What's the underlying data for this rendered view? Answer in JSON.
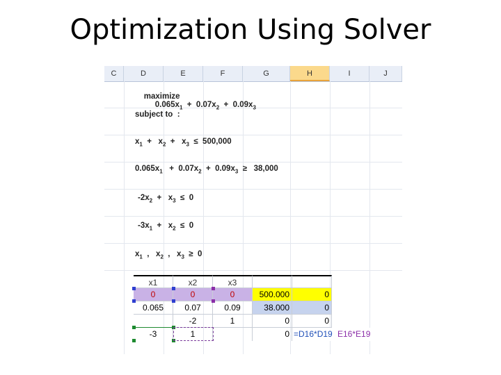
{
  "slide": {
    "title": "Optimization Using Solver"
  },
  "sheet": {
    "columns": [
      "C",
      "D",
      "E",
      "F",
      "G",
      "H",
      "I",
      "J"
    ],
    "active_column": "H",
    "model": {
      "maximize_label": "maximize",
      "objective": [
        "0.065x",
        "1",
        "  +  0.07x",
        "2",
        "  +  0.09x",
        "3"
      ],
      "subject_to": "subject to  :",
      "c1": [
        "x",
        "1",
        "  +   x",
        "2",
        "  +   x",
        "3",
        "  ≤  500,000"
      ],
      "c2": [
        "0.065x",
        "1",
        "   +  0.07x",
        "2",
        "  +  0.09x",
        "3",
        "  ≥   38,000"
      ],
      "c3": [
        "-2x",
        "2",
        "  +   x",
        "3",
        "  ≤  0"
      ],
      "c4": [
        "-3x",
        "1",
        "  +   x",
        "2",
        "  ≤  0"
      ],
      "c5": [
        "x",
        "1",
        "  ,   x",
        "2",
        "  ,   x",
        "3",
        "  ≥  0"
      ]
    },
    "table": {
      "headers": [
        "x1",
        "x2",
        "x3"
      ],
      "row_vars": [
        "0",
        "0",
        "0"
      ],
      "row_vars_total": "500.000",
      "row_vars_h": "0",
      "row_c2": [
        "0.065",
        "0.07",
        "0.09"
      ],
      "row_c2_total": "38.000",
      "row_c2_h": "0",
      "row_c3": [
        "",
        "-2",
        "1"
      ],
      "row_c3_g": "0",
      "row_c3_h": "0",
      "row_c4": [
        "-3",
        "1",
        ""
      ],
      "row_c4_g": "0",
      "formula_a": "=D16*D19",
      "formula_b": "E16*E19"
    }
  }
}
